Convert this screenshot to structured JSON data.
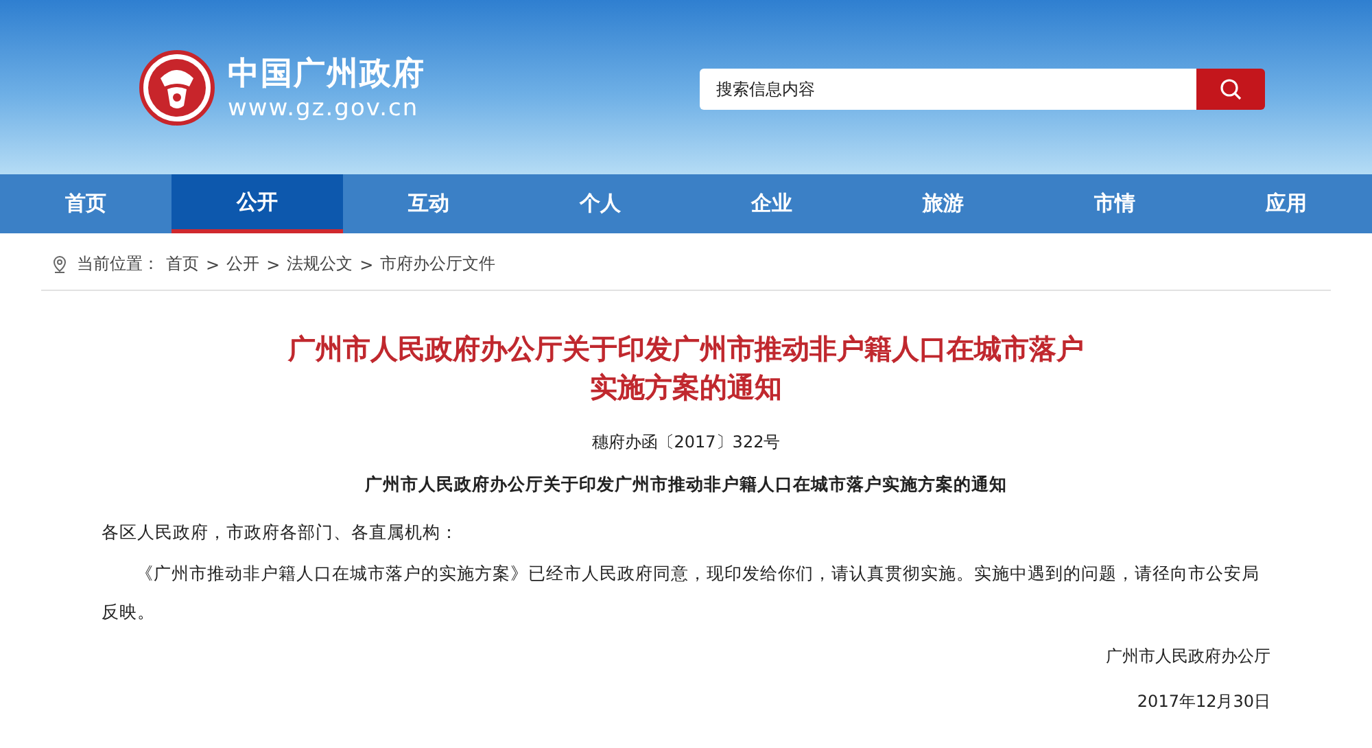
{
  "header": {
    "site_name": "中国广州政府",
    "site_url": "www.gz.gov.cn",
    "search": {
      "placeholder": "搜索信息内容"
    }
  },
  "nav": [
    {
      "label": "首页",
      "selected": false
    },
    {
      "label": "公开",
      "selected": true
    },
    {
      "label": "互动",
      "selected": false
    },
    {
      "label": "个人",
      "selected": false
    },
    {
      "label": "企业",
      "selected": false
    },
    {
      "label": "旅游",
      "selected": false
    },
    {
      "label": "市情",
      "selected": false
    },
    {
      "label": "应用",
      "selected": false
    }
  ],
  "breadcrumb": {
    "label": "当前位置：",
    "items": [
      "首页",
      "公开",
      "法规公文",
      "市府办公厅文件"
    ],
    "separator": ">"
  },
  "article": {
    "title": "广州市人民政府办公厅关于印发广州市推动非户籍人口在城市落户实施方案的通知",
    "doc_number": "穗府办函〔2017〕322号",
    "subtitle": "广州市人民政府办公厅关于印发广州市推动非户籍人口在城市落户实施方案的通知",
    "salutation": "各区人民政府，市政府各部门、各直属机构：",
    "body": "《广州市推动非户籍人口在城市落户的实施方案》已经市人民政府同意，现印发给你们，请认真贯彻实施。实施中遇到的问题，请径向市公安局反映。",
    "signature": "广州市人民政府办公厅",
    "date": "2017年12月30日"
  }
}
